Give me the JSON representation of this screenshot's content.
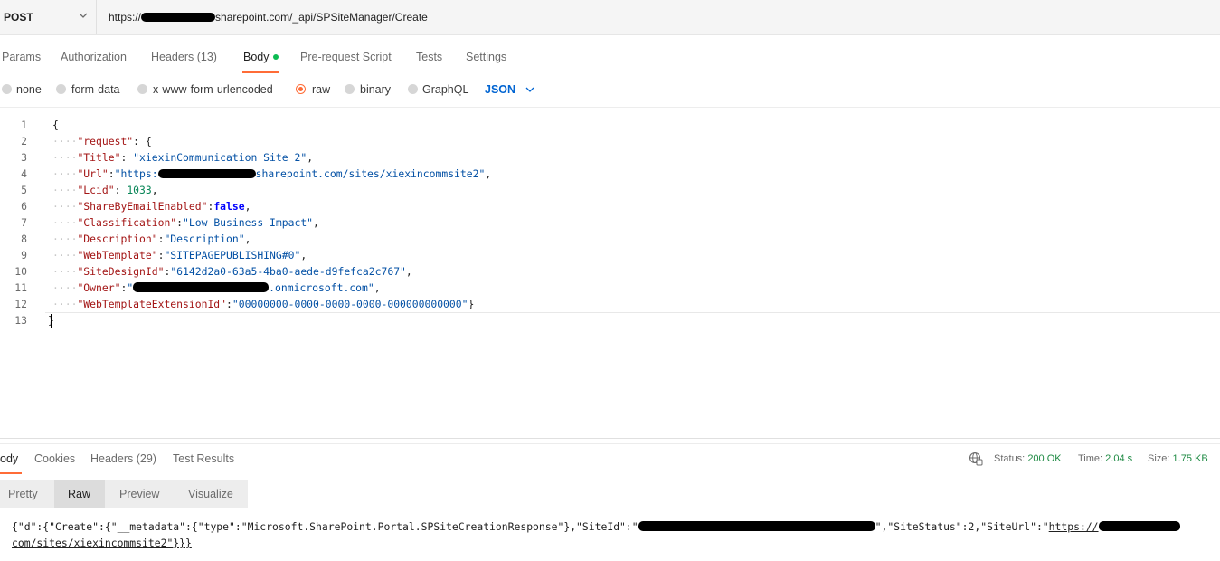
{
  "request": {
    "method": "POST",
    "url_prefix": "https://",
    "url_suffix": "sharepoint.com/_api/SPSiteManager/Create"
  },
  "tabs": [
    {
      "label": "Params"
    },
    {
      "label": "Authorization"
    },
    {
      "label": "Headers (13)"
    },
    {
      "label": "Body"
    },
    {
      "label": "Pre-request Script"
    },
    {
      "label": "Tests"
    },
    {
      "label": "Settings"
    }
  ],
  "body_types": [
    {
      "label": "none"
    },
    {
      "label": "form-data"
    },
    {
      "label": "x-www-form-urlencoded"
    },
    {
      "label": "raw"
    },
    {
      "label": "binary"
    },
    {
      "label": "GraphQL"
    }
  ],
  "selected_format": "JSON",
  "editor": {
    "line_numbers": [
      "1",
      "2",
      "3",
      "4",
      "5",
      "6",
      "7",
      "8",
      "9",
      "10",
      "11",
      "12",
      "13"
    ],
    "l1": "{",
    "l2_key": "\"request\"",
    "l2_rest": ": {",
    "l3_key": "\"Title\"",
    "l3_val": "\"xiexinCommunication Site 2\"",
    "l4_key": "\"Url\"",
    "l4_val_a": "\"https:",
    "l4_val_b": "sharepoint.com/sites/xiexincommsite2\"",
    "l5_key": "\"Lcid\"",
    "l5_val": "1033",
    "l6_key": "\"ShareByEmailEnabled\"",
    "l6_val": "false",
    "l7_key": "\"Classification\"",
    "l7_val": "\"Low Business Impact\"",
    "l8_key": "\"Description\"",
    "l8_val": "\"Description\"",
    "l9_key": "\"WebTemplate\"",
    "l9_val": "\"SITEPAGEPUBLISHING#0\"",
    "l10_key": "\"SiteDesignId\"",
    "l10_val": "\"6142d2a0-63a5-4ba0-aede-d9fefca2c767\"",
    "l11_key": "\"Owner\"",
    "l11_val_a": "\"",
    "l11_val_b": ".onmicrosoft.com\"",
    "l12_key": "\"WebTemplateExtensionId\"",
    "l12_val": "\"00000000-0000-0000-0000-000000000000\"",
    "l12_close": "}",
    "l13": "}"
  },
  "response": {
    "tabs": [
      {
        "label": "ody"
      },
      {
        "label": "Cookies"
      },
      {
        "label": "Headers (29)"
      },
      {
        "label": "Test Results"
      }
    ],
    "status_label": "Status:",
    "status_value": "200 OK",
    "time_label": "Time:",
    "time_value": "2.04 s",
    "size_label": "Size:",
    "size_value": "1.75 KB",
    "formats": [
      {
        "label": "Pretty"
      },
      {
        "label": "Raw"
      },
      {
        "label": "Preview"
      },
      {
        "label": "Visualize"
      }
    ],
    "raw_line1_a": "{\"d\":{\"Create\":{\"__metadata\":{\"type\":\"Microsoft.SharePoint.Portal.SPSiteCreationResponse\"},\"SiteId\":\"",
    "raw_line1_b": "\",\"SiteStatus\":2,\"SiteUrl\":\"",
    "raw_line1_c": "https://",
    "raw_line2": "com/sites/xiexincommsite2\"}}}"
  },
  "colors": {
    "accent": "#ff6c37",
    "link": "#0265d2",
    "status_ok": "#1e8a43",
    "key": "#a31515",
    "string": "#0451a5",
    "number": "#098658"
  }
}
